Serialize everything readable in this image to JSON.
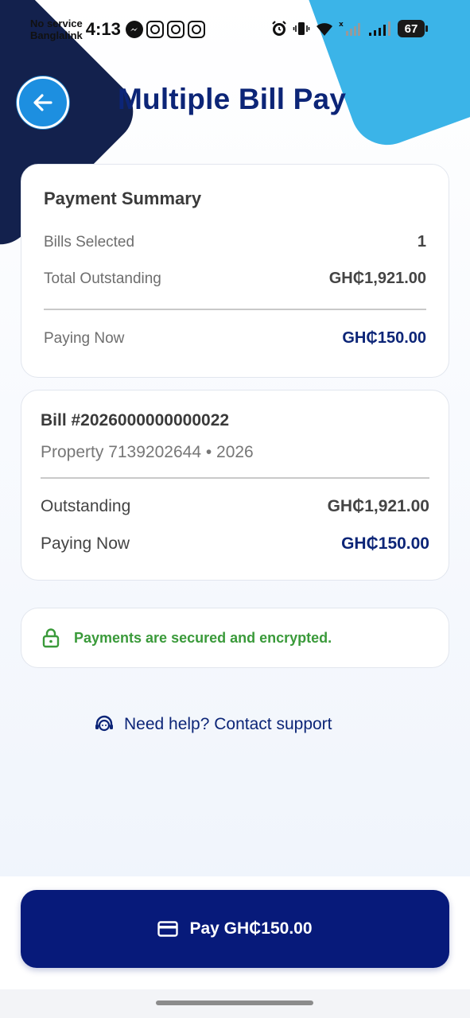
{
  "status_bar": {
    "carrier_line1": "No service",
    "carrier_line2": "Banglalink",
    "time": "4:13",
    "battery": "67"
  },
  "header": {
    "title": "Multiple Bill Pay"
  },
  "summary": {
    "title": "Payment Summary",
    "bills_selected_label": "Bills Selected",
    "bills_selected_value": "1",
    "total_outstanding_label": "Total Outstanding",
    "total_outstanding_value": "GH₵1,921.00",
    "paying_now_label": "Paying Now",
    "paying_now_value": "GH₵150.00"
  },
  "bill": {
    "title": "Bill #2026000000000022",
    "subtitle": "Property 7139202644 • 2026",
    "outstanding_label": "Outstanding",
    "outstanding_value": "GH₵1,921.00",
    "paying_now_label": "Paying Now",
    "paying_now_value": "GH₵150.00"
  },
  "security": {
    "text": "Payments are secured and encrypted."
  },
  "help": {
    "text": "Need help? Contact support"
  },
  "pay_button": {
    "label": "Pay GH₵150.00"
  },
  "colors": {
    "primary": "#0c2577",
    "button": "#071a7a",
    "back_button": "#1d8fe0",
    "secure": "#3a9a3a",
    "deco_dark": "#13214d",
    "deco_blue": "#3bb4e8"
  }
}
